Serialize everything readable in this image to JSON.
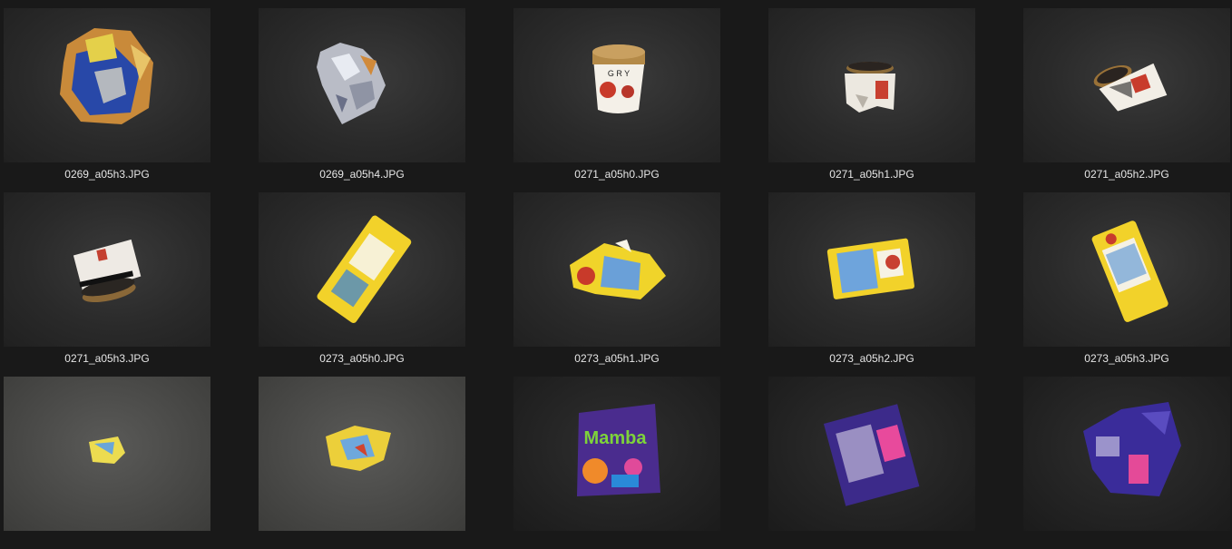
{
  "files": [
    {
      "name": "0269_a05h3.JPG",
      "subject": "crumpled-foil-wrapper-blue-gold"
    },
    {
      "name": "0269_a05h4.JPG",
      "subject": "crumpled-silver-foil"
    },
    {
      "name": "0271_a05h0.JPG",
      "subject": "ice-cream-cup"
    },
    {
      "name": "0271_a05h1.JPG",
      "subject": "crushed-ice-cream-cup"
    },
    {
      "name": "0271_a05h2.JPG",
      "subject": "crushed-ice-cream-cup-tilted"
    },
    {
      "name": "0271_a05h3.JPG",
      "subject": "crushed-ice-cream-cup-side"
    },
    {
      "name": "0273_a05h0.JPG",
      "subject": "yellow-snack-bag"
    },
    {
      "name": "0273_a05h1.JPG",
      "subject": "yellow-snack-bag-crumpled"
    },
    {
      "name": "0273_a05h2.JPG",
      "subject": "yellow-snack-bag-flat"
    },
    {
      "name": "0273_a05h3.JPG",
      "subject": "yellow-snack-bag-rotated"
    },
    {
      "name": "",
      "subject": "small-crumpled-yellow-wrapper"
    },
    {
      "name": "",
      "subject": "crumpled-yellow-wrapper"
    },
    {
      "name": "",
      "subject": "mamba-candy-bag"
    },
    {
      "name": "",
      "subject": "purple-candy-bag-back"
    },
    {
      "name": "",
      "subject": "purple-candy-bag-crumpled"
    }
  ],
  "mamba_logo_text": "Mamba"
}
